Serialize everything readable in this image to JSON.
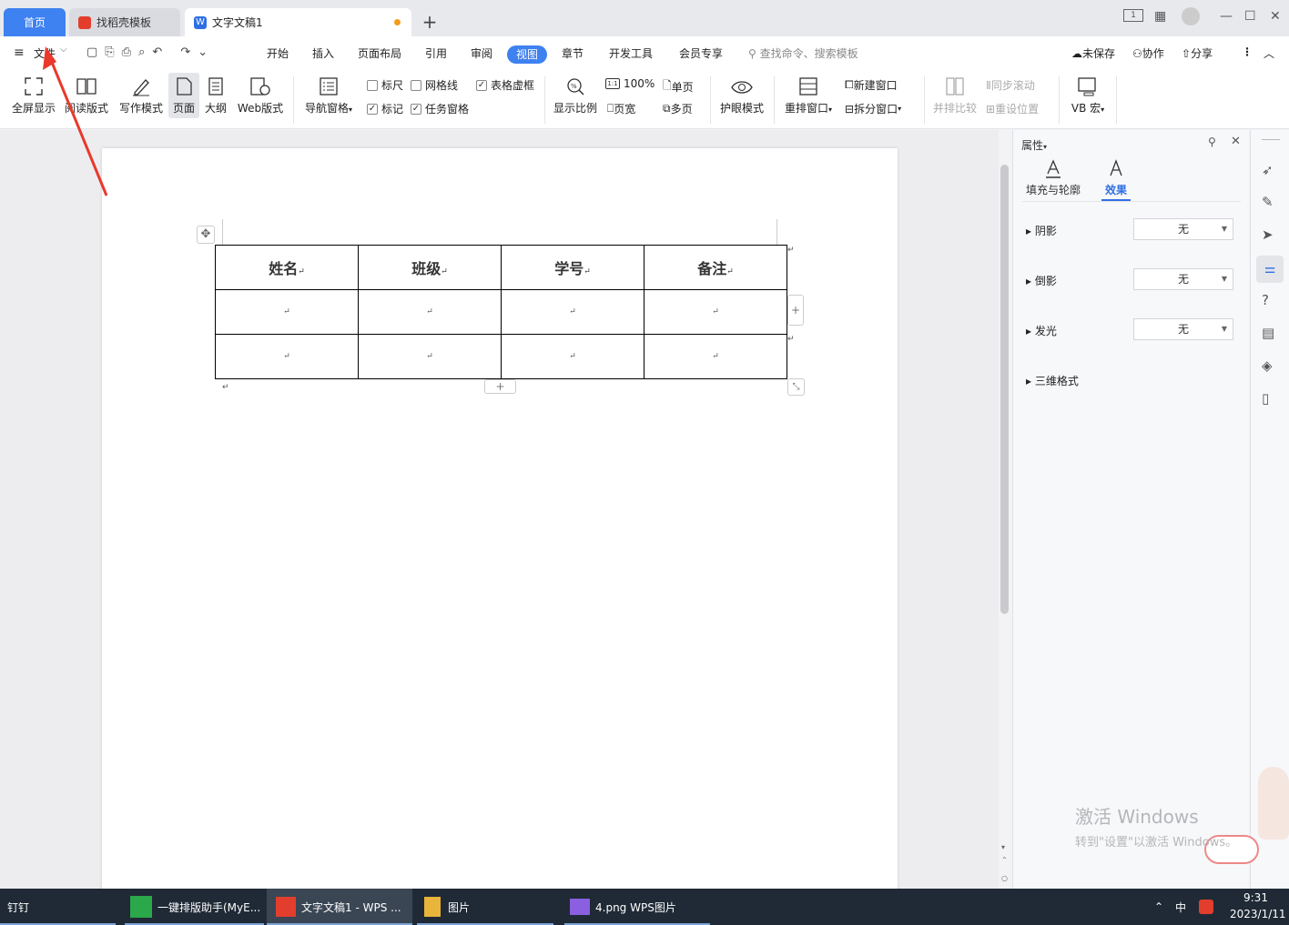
{
  "tabs": {
    "home": "首页",
    "template": "找稻壳模板",
    "document": "文字文稿1"
  },
  "menubar": {
    "file": "文件",
    "tabs": [
      "开始",
      "插入",
      "页面布局",
      "引用",
      "审阅",
      "视图",
      "章节",
      "开发工具",
      "会员专享"
    ],
    "search_placeholder": "查找命令、搜索模板",
    "unsaved": "未保存",
    "collaborate": "协作",
    "share": "分享"
  },
  "ribbon": {
    "fullscreen": "全屏显示",
    "read": "阅读版式",
    "write": "写作模式",
    "page": "页面",
    "outline": "大纲",
    "web": "Web版式",
    "nav": "导航窗格",
    "ruler": "标尺",
    "grid": "网格线",
    "table_frame": "表格虚框",
    "mark": "标记",
    "task_pane": "任务窗格",
    "zoom": "显示比例",
    "zoom100": "100%",
    "single": "单页",
    "page_width": "页宽",
    "multi": "多页",
    "eye": "护眼模式",
    "rearrange": "重排窗口",
    "new_window": "新建窗口",
    "split": "拆分窗口",
    "compare": "并排比较",
    "sync_scroll": "同步滚动",
    "reset_pos": "重设位置",
    "vb": "VB 宏"
  },
  "table": {
    "headers": [
      "姓名",
      "班级",
      "学号",
      "备注"
    ],
    "mark": "↵"
  },
  "panel": {
    "title": "属性",
    "tab_fill": "填充与轮廓",
    "tab_effect": "效果",
    "shadow": "阴影",
    "reflection": "倒影",
    "glow": "发光",
    "three_d": "三维格式",
    "none": "无"
  },
  "activate": {
    "line1": "激活 Windows",
    "line2": "转到\"设置\"以激活 Windows。"
  },
  "taskbar": {
    "dingtalk": "钉钉",
    "helper": "一键排版助手(MyE...",
    "wps": "文字文稿1 - WPS ...",
    "pictures": "图片",
    "png": "4.png  WPS图片",
    "ime": "中",
    "time": "9:31",
    "date": "2023/1/11"
  },
  "colors": {
    "accent": "#3e81f0",
    "arrow": "#e8392c"
  }
}
